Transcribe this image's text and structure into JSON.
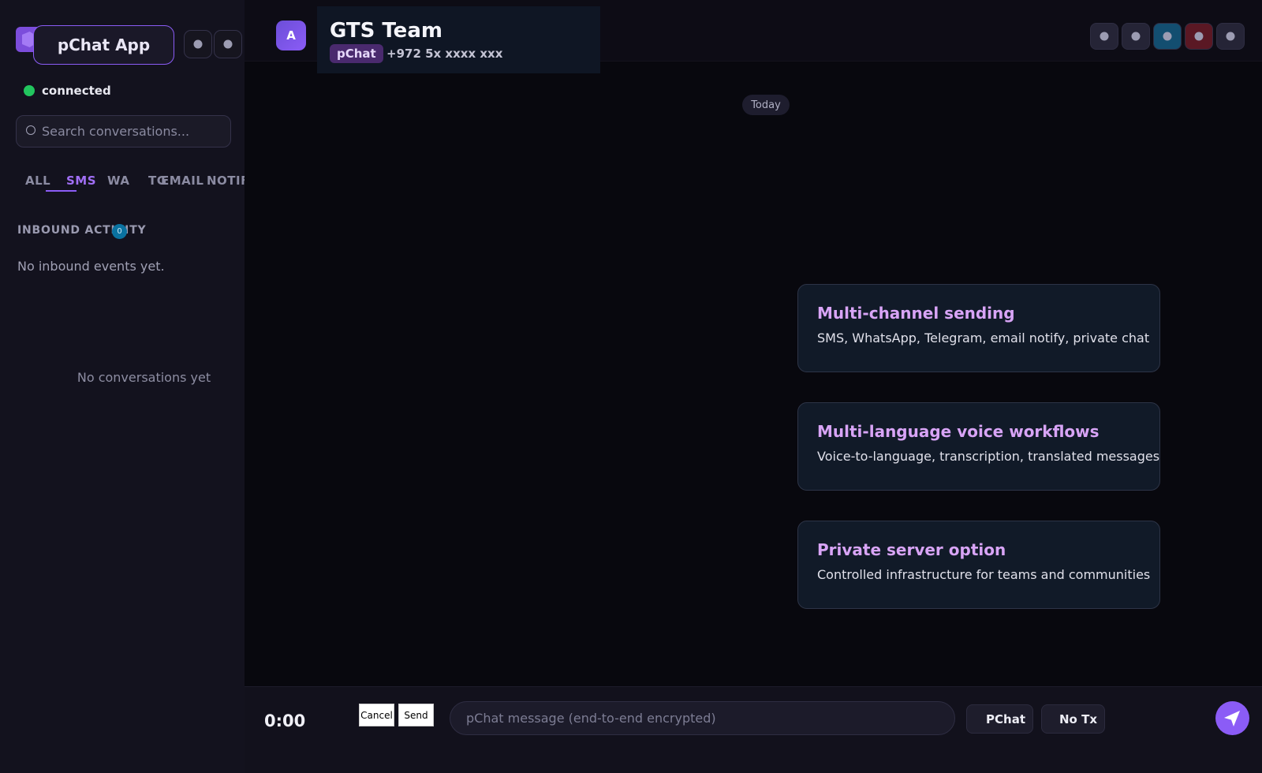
{
  "app": {
    "title": "pChat App",
    "status": "connected",
    "status_color": "#22c55e",
    "accent": "#8b5cf6"
  },
  "sidebar": {
    "search_placeholder": "Search conversations...",
    "tabs": [
      {
        "label": "ALL",
        "active": false
      },
      {
        "label": "SMS",
        "active": true
      },
      {
        "label": "WA",
        "active": false
      },
      {
        "label": "TG",
        "active": false
      },
      {
        "label": "EMAIL",
        "active": false
      },
      {
        "label": "NOTIF",
        "active": false
      }
    ],
    "inbound": {
      "title": "INBOUND ACTIVITY",
      "count": "0",
      "empty_text": "No inbound events yet."
    },
    "conversations_empty": "No conversations yet"
  },
  "header": {
    "avatar_initial": "A",
    "contact_name": "GTS Team",
    "channel": "pChat",
    "phone": "+972 5x xxxx xxx"
  },
  "chat": {
    "date_label": "Today",
    "features": [
      {
        "title": "Multi-channel sending",
        "desc": "SMS, WhatsApp, Telegram, email notify, private chat"
      },
      {
        "title": "Multi-language voice workflows",
        "desc": "Voice-to-language, transcription, translated messages"
      },
      {
        "title": "Private server option",
        "desc": "Controlled infrastructure for teams and communities"
      }
    ]
  },
  "composer": {
    "timer": "0:00",
    "cancel_label": "Cancel",
    "send_label": "Send",
    "placeholder": "pChat message (end-to-end encrypted)",
    "channel_chip": "PChat",
    "tx_chip": "No Tx"
  }
}
